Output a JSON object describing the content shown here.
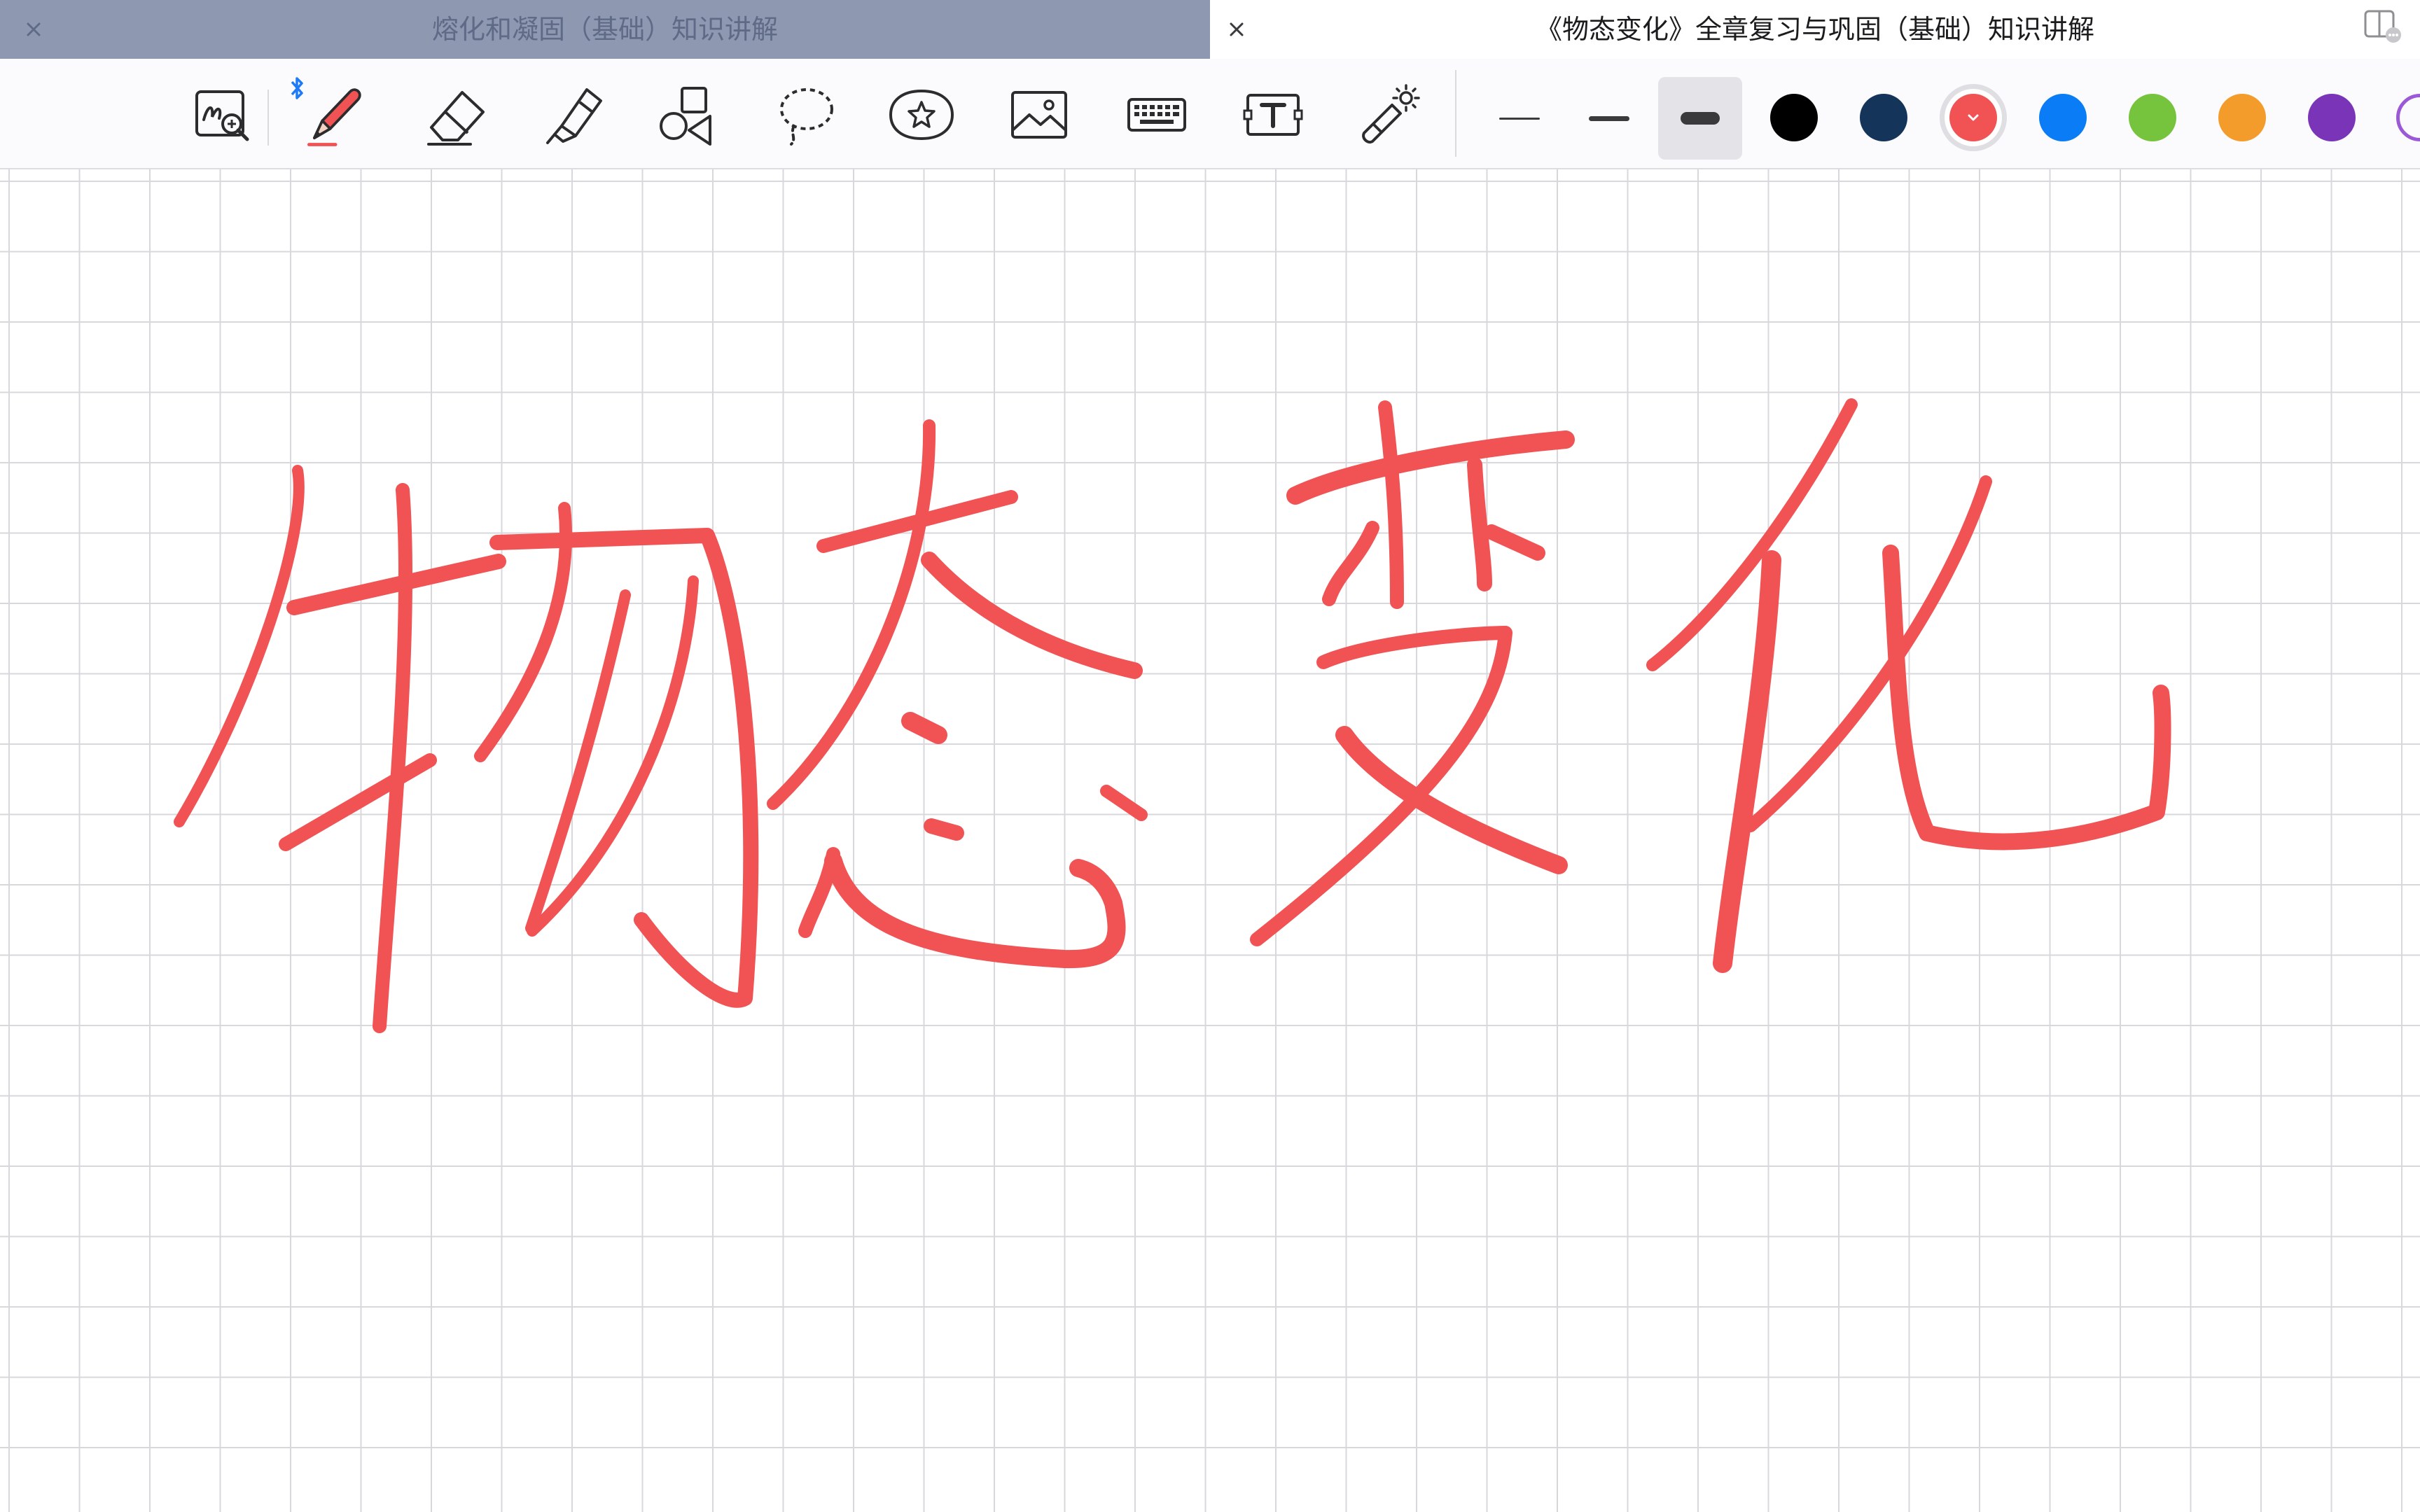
{
  "tabs": [
    {
      "title": "熔化和凝固（基础）知识讲解",
      "active": false
    },
    {
      "title": "《物态变化》全章复习与巩固（基础）知识讲解",
      "active": true
    }
  ],
  "toolbar": {
    "tools": [
      {
        "name": "zoom-window-icon"
      },
      {
        "name": "pen-icon",
        "active": true,
        "bluetooth": true
      },
      {
        "name": "eraser-icon"
      },
      {
        "name": "highlighter-icon"
      },
      {
        "name": "shapes-icon"
      },
      {
        "name": "lasso-icon"
      },
      {
        "name": "sticker-icon"
      },
      {
        "name": "image-icon"
      },
      {
        "name": "keyboard-icon"
      },
      {
        "name": "text-box-icon"
      },
      {
        "name": "laser-pointer-icon"
      }
    ],
    "stroke_widths": [
      "thin",
      "medium",
      "thick"
    ],
    "selected_stroke": "thick",
    "colors": [
      "#000000",
      "#14345a",
      "#f15253",
      "#0a7cf5",
      "#76c43d",
      "#f39c2b",
      "#7a34b8"
    ],
    "selected_color": "#f15253"
  },
  "canvas": {
    "background": "grid",
    "ink_color": "#f15253",
    "handwritten_text": "物态变化"
  }
}
